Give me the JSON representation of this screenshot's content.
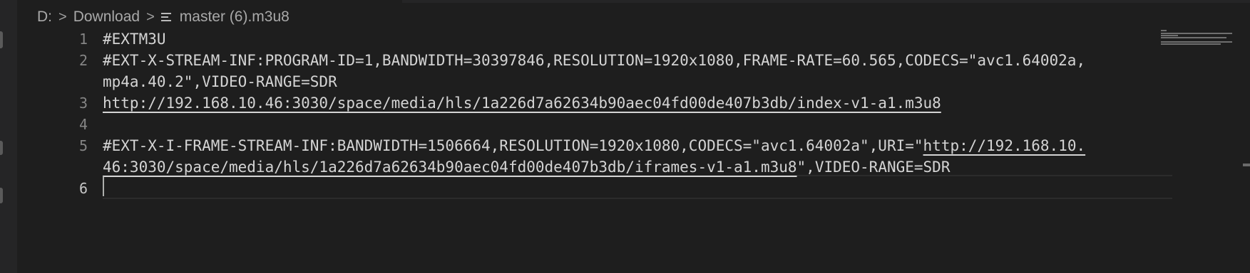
{
  "breadcrumb": {
    "drive": "D:",
    "folder": "Download",
    "separator": ">",
    "file": "master (6).m3u8",
    "file_icon": "list-file-icon"
  },
  "editor": {
    "line_numbers": [
      "1",
      "2",
      "3",
      "4",
      "5",
      "6"
    ],
    "lines": {
      "l1": "#EXTM3U",
      "l2a": "#EXT-X-STREAM-INF:PROGRAM-ID=1,BANDWIDTH=30397846,RESOLUTION=1920x1080,FRAME-RATE=60.565,CODECS=\"avc1.64002a,",
      "l2b": "mp4a.40.2\",VIDEO-RANGE=SDR",
      "l3_link": "http://192.168.10.46:3030/space/media/hls/1a226d7a62634b90aec04fd00de407b3db/index-v1-a1.m3u8",
      "l5a_text": "#EXT-X-I-FRAME-STREAM-INF:BANDWIDTH=1506664,RESOLUTION=1920x1080,CODECS=\"avc1.64002a\",URI=\"",
      "l5a_link": "http://192.168.10.",
      "l5b_link": "46:3030/space/media/hls/1a226d7a62634b90aec04fd00de407b3db/iframes-v1-a1.m3u8",
      "l5b_text": "\",VIDEO-RANGE=SDR",
      "l6": ""
    }
  },
  "colors": {
    "background": "#1e1e1e",
    "text": "#d4d4d4",
    "line_number": "#858585",
    "active_line_number": "#c6c6c6"
  }
}
